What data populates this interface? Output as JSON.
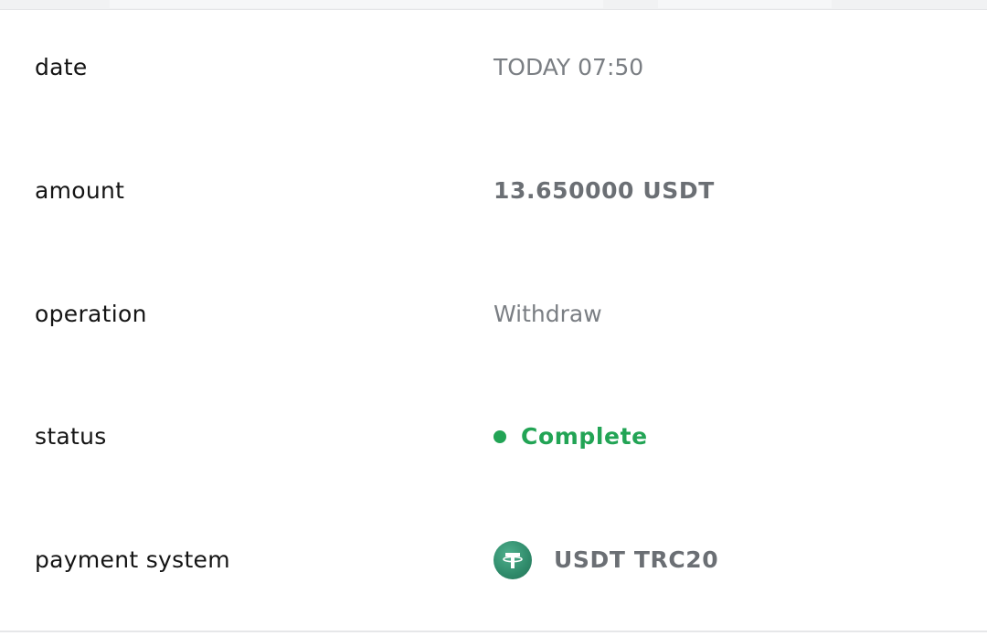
{
  "colors": {
    "status_complete": "#22a455",
    "tether_green": "#2f8a6a",
    "label_text": "#141414",
    "value_text": "#777b80"
  },
  "rows": [
    {
      "label": "date",
      "value": "TODAY 07:50"
    },
    {
      "label": "amount",
      "value": "13.650000 USDT"
    },
    {
      "label": "operation",
      "value": "Withdraw"
    },
    {
      "label": "status",
      "value": "Complete"
    },
    {
      "label": "payment system",
      "value": "USDT TRC20",
      "icon": "tether-usdt-icon"
    }
  ]
}
